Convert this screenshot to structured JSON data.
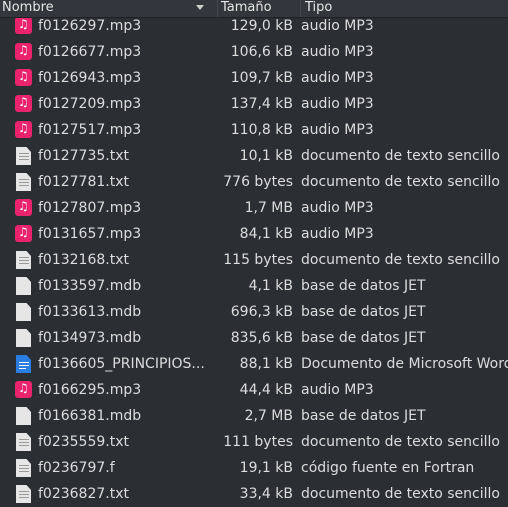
{
  "header": {
    "name_label": "Nombre",
    "size_label": "Tamaño",
    "type_label": "Tipo"
  },
  "icon_map": {
    "audio": "audio-file-icon",
    "text": "text-file-icon",
    "generic": "generic-file-icon",
    "word": "word-document-icon"
  },
  "colors": {
    "background": "#2b2e33",
    "audio_icon": "#e9246c",
    "word_icon": "#2a7de1",
    "text": "#dcdcdc"
  },
  "files": [
    {
      "name": "f0126297.mp3",
      "size": "129,0 kB",
      "type": "audio MP3",
      "icon": "audio"
    },
    {
      "name": "f0126677.mp3",
      "size": "106,6 kB",
      "type": "audio MP3",
      "icon": "audio"
    },
    {
      "name": "f0126943.mp3",
      "size": "109,7 kB",
      "type": "audio MP3",
      "icon": "audio"
    },
    {
      "name": "f0127209.mp3",
      "size": "137,4 kB",
      "type": "audio MP3",
      "icon": "audio"
    },
    {
      "name": "f0127517.mp3",
      "size": "110,8 kB",
      "type": "audio MP3",
      "icon": "audio"
    },
    {
      "name": "f0127735.txt",
      "size": "10,1 kB",
      "type": "documento de texto sencillo",
      "icon": "text"
    },
    {
      "name": "f0127781.txt",
      "size": "776 bytes",
      "type": "documento de texto sencillo",
      "icon": "text"
    },
    {
      "name": "f0127807.mp3",
      "size": "1,7 MB",
      "type": "audio MP3",
      "icon": "audio"
    },
    {
      "name": "f0131657.mp3",
      "size": "84,1 kB",
      "type": "audio MP3",
      "icon": "audio"
    },
    {
      "name": "f0132168.txt",
      "size": "115 bytes",
      "type": "documento de texto sencillo",
      "icon": "text"
    },
    {
      "name": "f0133597.mdb",
      "size": "4,1 kB",
      "type": "base de datos JET",
      "icon": "generic"
    },
    {
      "name": "f0133613.mdb",
      "size": "696,3 kB",
      "type": "base de datos JET",
      "icon": "generic"
    },
    {
      "name": "f0134973.mdb",
      "size": "835,6 kB",
      "type": "base de datos JET",
      "icon": "generic"
    },
    {
      "name": "f0136605_PRINCIPIOS...",
      "size": "88,1 kB",
      "type": "Documento de Microsoft Word",
      "icon": "word"
    },
    {
      "name": "f0166295.mp3",
      "size": "44,4 kB",
      "type": "audio MP3",
      "icon": "audio"
    },
    {
      "name": "f0166381.mdb",
      "size": "2,7 MB",
      "type": "base de datos JET",
      "icon": "generic"
    },
    {
      "name": "f0235559.txt",
      "size": "111 bytes",
      "type": "documento de texto sencillo",
      "icon": "text"
    },
    {
      "name": "f0236797.f",
      "size": "19,1 kB",
      "type": "código fuente en Fortran",
      "icon": "text"
    },
    {
      "name": "f0236827.txt",
      "size": "33,4 kB",
      "type": "documento de texto sencillo",
      "icon": "text"
    }
  ]
}
